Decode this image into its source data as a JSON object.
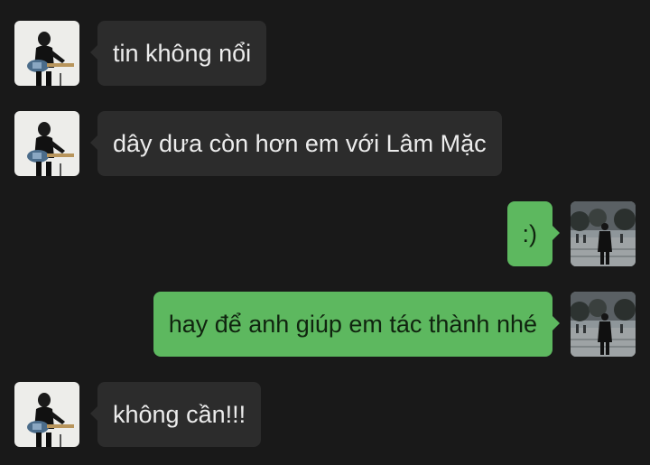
{
  "colors": {
    "background": "#191919",
    "incoming_bubble": "#2c2c2c",
    "outgoing_bubble": "#5db85f"
  },
  "messages": [
    {
      "sender": "other",
      "avatar": "guitarist-avatar-icon",
      "text": "tin không nổi"
    },
    {
      "sender": "other",
      "avatar": "guitarist-avatar-icon",
      "text": "dây dưa còn hơn em với Lâm Mặc"
    },
    {
      "sender": "self",
      "avatar": "street-photo-avatar-icon",
      "text": ":)"
    },
    {
      "sender": "self",
      "avatar": "street-photo-avatar-icon",
      "text": "hay để anh giúp em tác thành nhé"
    },
    {
      "sender": "other",
      "avatar": "guitarist-avatar-icon",
      "text": "không cần!!!"
    }
  ]
}
